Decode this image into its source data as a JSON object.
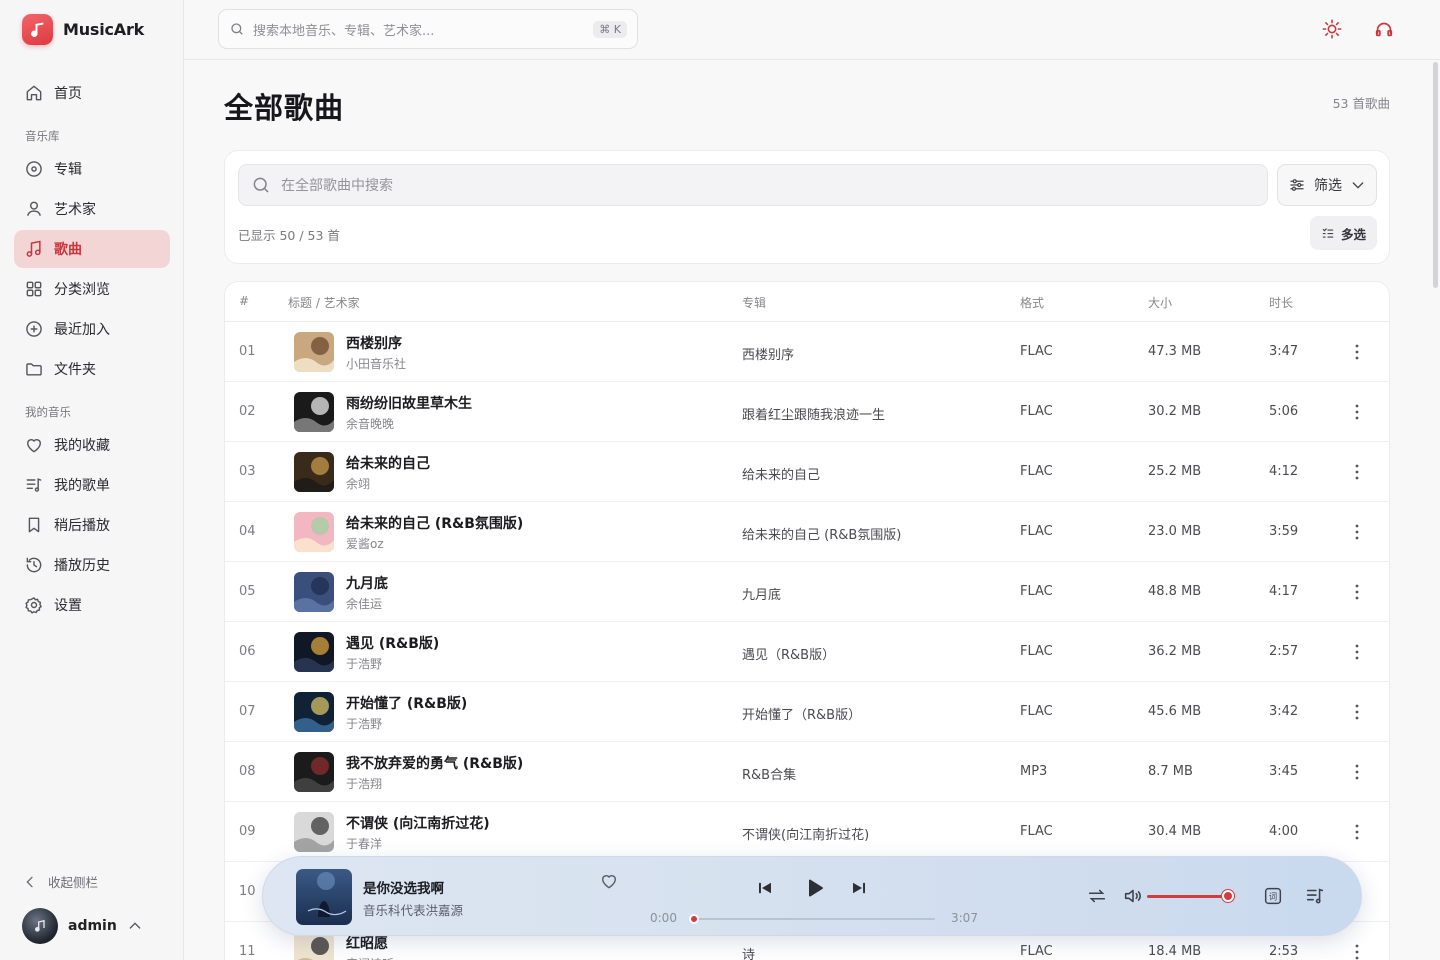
{
  "app": {
    "name": "MusicArk",
    "accent": "#c8373d"
  },
  "topbar": {
    "search_placeholder": "搜索本地音乐、专辑、艺术家...",
    "shortcut": "⌘ K"
  },
  "sidebar": {
    "home": "首页",
    "section_library": "音乐库",
    "albums": "专辑",
    "artists": "艺术家",
    "songs": "歌曲",
    "browse": "分类浏览",
    "recent": "最近加入",
    "folders": "文件夹",
    "section_mine": "我的音乐",
    "favorites": "我的收藏",
    "playlists": "我的歌单",
    "later": "稍后播放",
    "history": "播放历史",
    "settings": "设置",
    "collapse": "收起侧栏",
    "user": "admin"
  },
  "main": {
    "title": "全部歌曲",
    "count": "53 首歌曲",
    "search_placeholder": "在全部歌曲中搜索",
    "filter_label": "筛选",
    "shown": "已显示 50 / 53 首",
    "multi_select": "多选"
  },
  "table": {
    "headers": {
      "num": "#",
      "title": "标题 / 艺术家",
      "album": "专辑",
      "format": "格式",
      "size": "大小",
      "duration": "时长"
    },
    "rows": [
      {
        "num": "01",
        "title": "西楼别序",
        "artist": "小田音乐社",
        "album": "西楼别序",
        "format": "FLAC",
        "size": "47.3 MB",
        "duration": "3:47"
      },
      {
        "num": "02",
        "title": "雨纷纷旧故里草木生",
        "artist": "余音晚晚",
        "album": "跟着红尘跟随我浪迹一生",
        "format": "FLAC",
        "size": "30.2 MB",
        "duration": "5:06"
      },
      {
        "num": "03",
        "title": "给未来的自己",
        "artist": "余翊",
        "album": "给未来的自己",
        "format": "FLAC",
        "size": "25.2 MB",
        "duration": "4:12"
      },
      {
        "num": "04",
        "title": "给未来的自己 (R&B氛围版)",
        "artist": "爱酱oz",
        "album": "给未来的自己 (R&B氛围版)",
        "format": "FLAC",
        "size": "23.0 MB",
        "duration": "3:59"
      },
      {
        "num": "05",
        "title": "九月底",
        "artist": "余佳运",
        "album": "九月底",
        "format": "FLAC",
        "size": "48.8 MB",
        "duration": "4:17"
      },
      {
        "num": "06",
        "title": "遇见 (R&B版)",
        "artist": "于浩野",
        "album": "遇见（R&B版）",
        "format": "FLAC",
        "size": "36.2 MB",
        "duration": "2:57"
      },
      {
        "num": "07",
        "title": "开始懂了 (R&B版)",
        "artist": "于浩野",
        "album": "开始懂了（R&B版）",
        "format": "FLAC",
        "size": "45.6 MB",
        "duration": "3:42"
      },
      {
        "num": "08",
        "title": "我不放弃爱的勇气 (R&B版)",
        "artist": "于浩翔",
        "album": "R&B合集",
        "format": "MP3",
        "size": "8.7 MB",
        "duration": "3:45"
      },
      {
        "num": "09",
        "title": "不谓侠 (向江南折过花)",
        "artist": "于春洋",
        "album": "不谓侠(向江南折过花)",
        "format": "FLAC",
        "size": "30.4 MB",
        "duration": "4:00"
      },
      {
        "num": "10",
        "title": "",
        "artist": "",
        "album": "",
        "format": "",
        "size": "",
        "duration": ""
      },
      {
        "num": "11",
        "title": "红昭愿",
        "artist": "音阙诗听",
        "album": "诗",
        "format": "FLAC",
        "size": "18.4 MB",
        "duration": "2:53"
      }
    ]
  },
  "player": {
    "title": "是你没选我啊",
    "artist": "音乐科代表洪嘉源",
    "current_time": "0:00",
    "total_time": "3:07",
    "progress": 0.0,
    "volume": 0.92
  }
}
